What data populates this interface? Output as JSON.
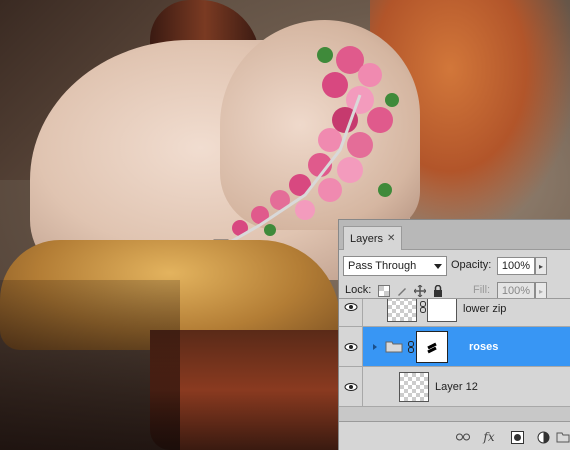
{
  "panel": {
    "tab_label": "Layers",
    "tab_close": "✕",
    "blend_mode": "Pass Through",
    "opacity_label": "Opacity:",
    "opacity_value": "100%",
    "lock_label": "Lock:",
    "fill_label": "Fill:",
    "fill_value": "100%"
  },
  "layers": [
    {
      "name": "lower zip",
      "type": "layer_with_mask",
      "selected": false
    },
    {
      "name": "roses",
      "type": "group",
      "selected": true
    },
    {
      "name": "Layer 12",
      "type": "layer",
      "selected": false
    }
  ],
  "bottom_icons": [
    "link-layers-icon",
    "fx-icon",
    "add-mask-icon",
    "adjustment-layer-icon",
    "new-group-icon"
  ],
  "colors": {
    "selected_row": "#3896f4",
    "panel_bg": "#d6d6d6",
    "tab_bar": "#b8b8b8"
  }
}
